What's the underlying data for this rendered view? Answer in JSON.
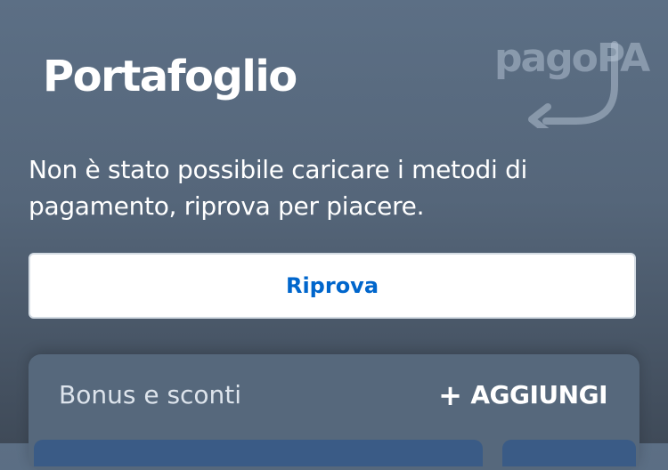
{
  "header": {
    "title": "Portafoglio",
    "logo_text": "pagoPA"
  },
  "error": {
    "message": "Non è stato possibile caricare i metodi di pagamento, riprova per piacere."
  },
  "retry_button": {
    "label": "Riprova"
  },
  "bonus_section": {
    "title": "Bonus e sconti",
    "add_label": "AGGIUNGI",
    "add_icon": "plus-icon"
  },
  "colors": {
    "background": "#5c6f85",
    "accent": "#0066cc",
    "card": "#56687c"
  }
}
